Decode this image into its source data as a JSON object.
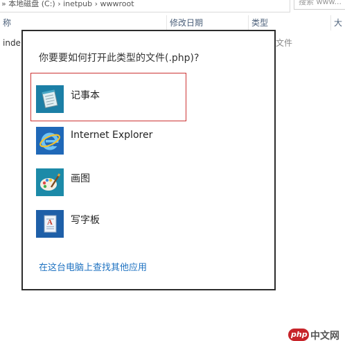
{
  "explorer": {
    "address_text": "» 本地磁盘 (C:) › inetpub › wwwroot",
    "search_placeholder": "搜索 www...",
    "columns": [
      {
        "label": "称"
      },
      {
        "label": "修改日期"
      },
      {
        "label": "类型"
      },
      {
        "label": "大"
      }
    ],
    "row_name": "inde",
    "row_type": "文件"
  },
  "dialog": {
    "title": "你要要如何打开此类型的文件(.php)?",
    "apps": [
      {
        "label": "记事本",
        "icon": "notepad-icon"
      },
      {
        "label": "Internet Explorer",
        "icon": "internet-explorer-icon"
      },
      {
        "label": "画图",
        "icon": "paint-icon"
      },
      {
        "label": "写字板",
        "icon": "wordpad-icon"
      }
    ],
    "more_apps_link": "在这台电脑上查找其他应用"
  },
  "watermark": {
    "badge": "php",
    "text": "中文网"
  },
  "colors": {
    "link": "#1e72c1",
    "highlight": "#cc3333",
    "dialog_border": "#2b2b2b",
    "icon_bg": "#1f7bb5"
  }
}
